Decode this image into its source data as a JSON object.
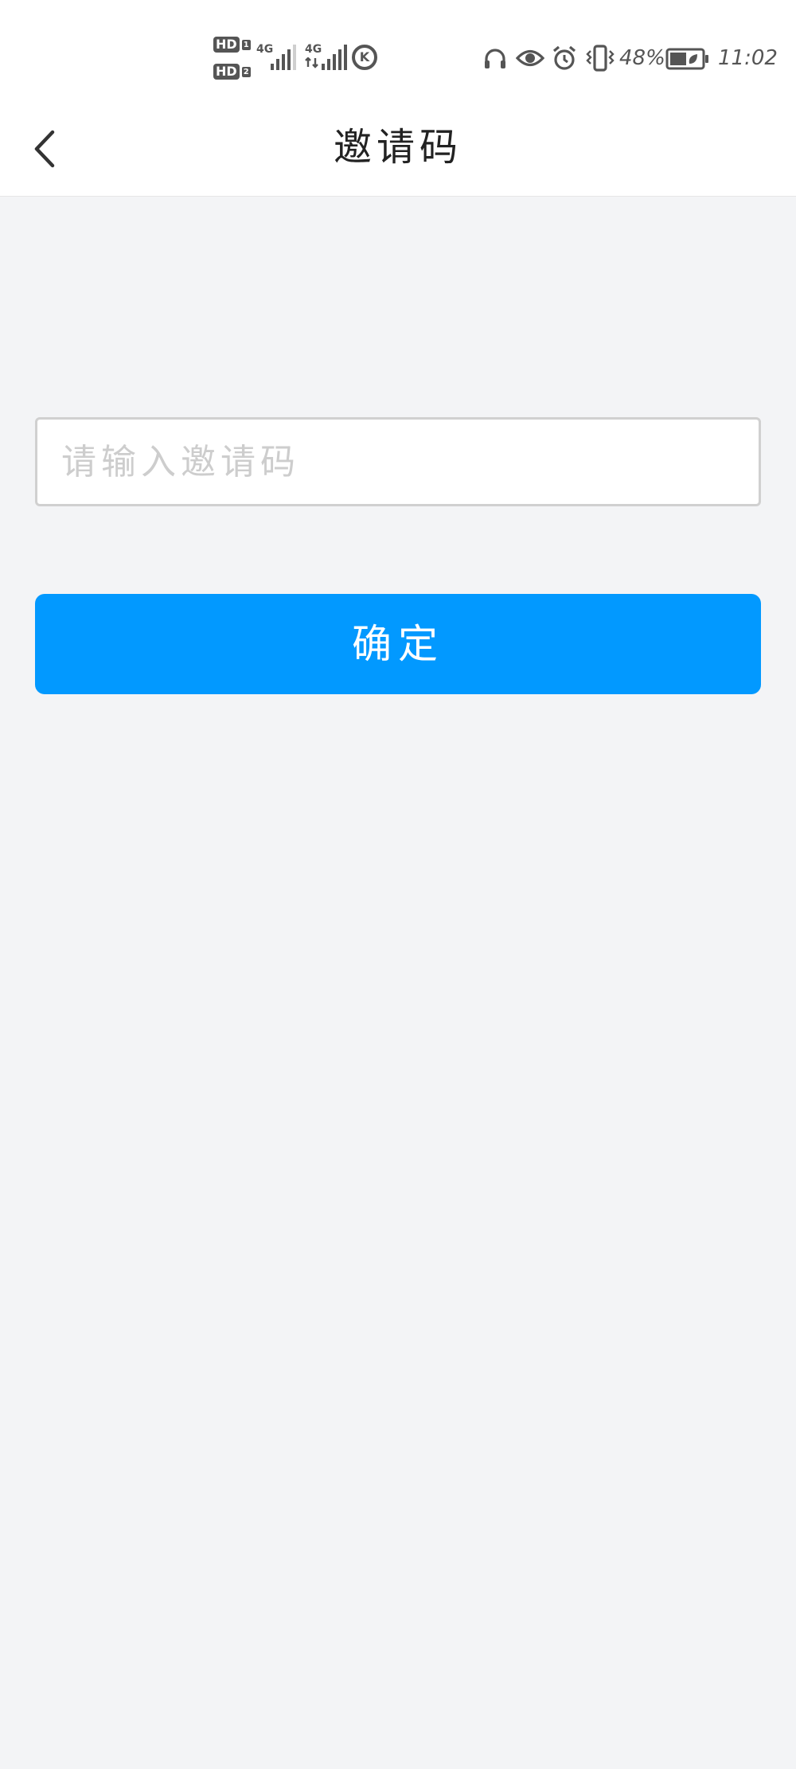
{
  "status_bar": {
    "sim1_label": "HD",
    "sim1_num": "1",
    "sim2_label": "HD",
    "sim2_num": "2",
    "net1": "4G",
    "net2": "4G",
    "k_badge": "K",
    "battery_percent": "48%",
    "time": "11:02",
    "icons": [
      "headphones-icon",
      "eye-icon",
      "alarm-icon",
      "vibrate-icon",
      "battery-icon"
    ]
  },
  "nav": {
    "title": "邀请码",
    "back_icon": "chevron-left-icon"
  },
  "form": {
    "input_placeholder": "请输入邀请码",
    "input_value": "",
    "confirm_label": "确定"
  },
  "colors": {
    "primary": "#0299ff",
    "background": "#f3f4f6",
    "surface": "#ffffff",
    "placeholder": "#cdcdcd"
  }
}
